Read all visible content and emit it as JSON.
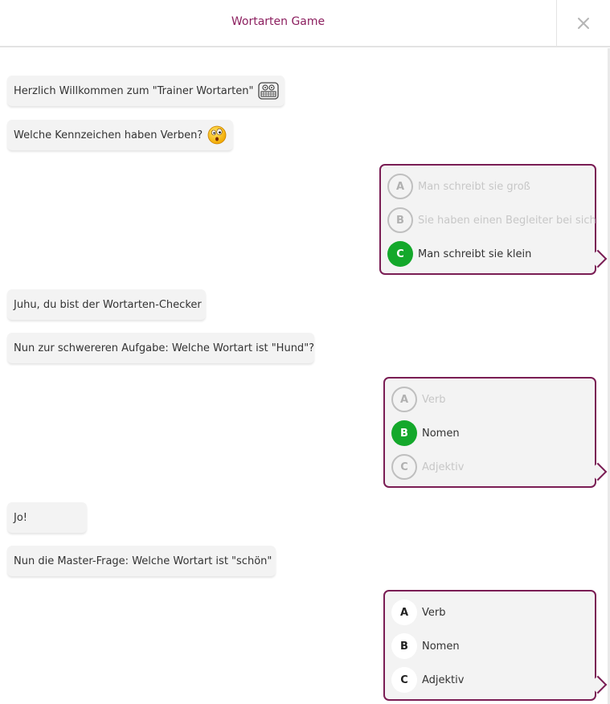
{
  "header": {
    "title": "Wortarten Game",
    "close_icon": "close-icon"
  },
  "messages": [
    {
      "text": "Herzlich Willkommen zum \"Trainer Wortarten\"",
      "emoji": "teeth-face-emoji"
    },
    {
      "text": "Welche Kennzeichen haben Verben?",
      "emoji": "surprised-face-emoji"
    },
    {
      "text": "Juhu, du bist der Wortarten-Checker"
    },
    {
      "text": "Nun zur schwereren Aufgabe: Welche Wortart ist \"Hund\"?"
    },
    {
      "text": "Jo!"
    },
    {
      "text": "Nun die Master-Frage: Welche Wortart ist \"schön\""
    }
  ],
  "questions": [
    {
      "options": [
        {
          "letter": "A",
          "text": "Man schreibt sie groß",
          "state": "disabled"
        },
        {
          "letter": "B",
          "text": "Sie haben einen Begleiter bei sich",
          "state": "disabled"
        },
        {
          "letter": "C",
          "text": "Man schreibt sie klein",
          "state": "correct"
        }
      ]
    },
    {
      "options": [
        {
          "letter": "A",
          "text": "Verb",
          "state": "disabled"
        },
        {
          "letter": "B",
          "text": "Nomen",
          "state": "correct"
        },
        {
          "letter": "C",
          "text": "Adjektiv",
          "state": "disabled"
        }
      ]
    },
    {
      "options": [
        {
          "letter": "A",
          "text": "Verb",
          "state": "open"
        },
        {
          "letter": "B",
          "text": "Nomen",
          "state": "open"
        },
        {
          "letter": "C",
          "text": "Adjektiv",
          "state": "open"
        }
      ]
    }
  ],
  "colors": {
    "accent": "#7a1d54",
    "title": "#8c1f5f",
    "correct": "#14a82b",
    "bubble": "#f3f3f3"
  }
}
